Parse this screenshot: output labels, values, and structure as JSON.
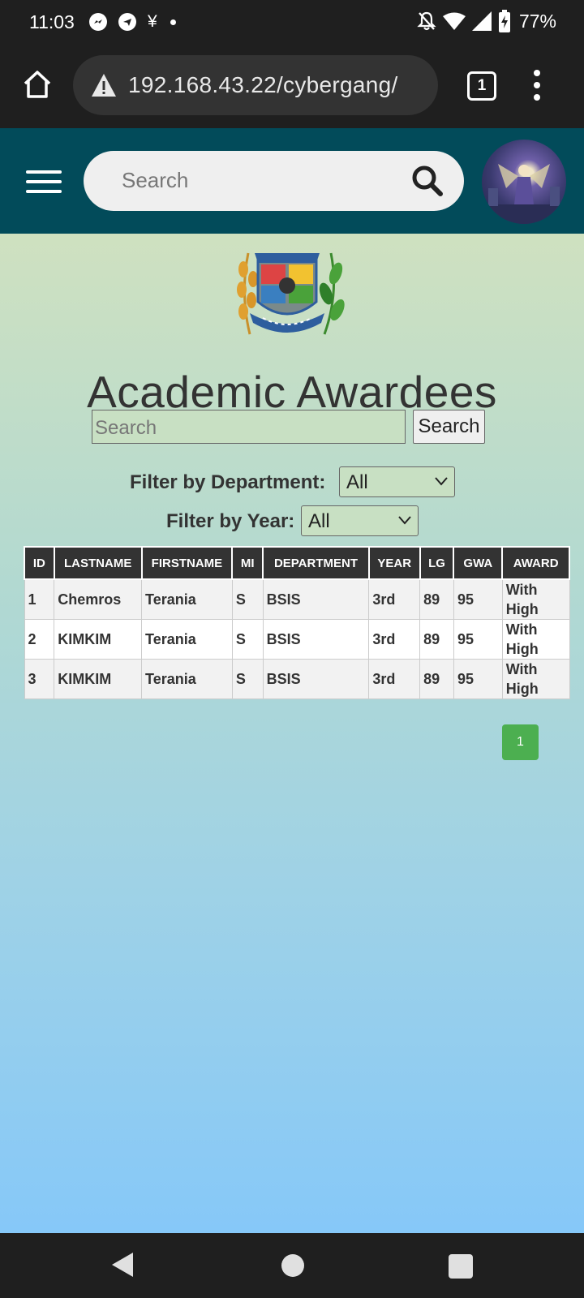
{
  "status_bar": {
    "time": "11:03",
    "notification_icons": [
      "messenger-icon",
      "telegram-icon",
      "yen-icon",
      "dot"
    ],
    "yen_symbol": "¥",
    "battery": "77%"
  },
  "browser": {
    "url": "192.168.43.22/cybergang/",
    "tab_count": "1"
  },
  "site_header": {
    "search_placeholder": "Search"
  },
  "page": {
    "title": "Academic Awardees",
    "search_placeholder": "Search",
    "search_button": "Search",
    "filter_department_label": "Filter by Department:",
    "filter_department_value": "All",
    "filter_year_label": "Filter by Year:",
    "filter_year_value": "All"
  },
  "table": {
    "headers": [
      "ID",
      "LASTNAME",
      "FIRSTNAME",
      "MI",
      "DEPARTMENT",
      "YEAR",
      "LG",
      "GWA",
      "AWARD"
    ],
    "rows": [
      [
        "1",
        "Chemros",
        "Terania",
        "S",
        "BSIS",
        "3rd",
        "89",
        "95",
        "With High"
      ],
      [
        "2",
        "KIMKIM",
        "Terania",
        "S",
        "BSIS",
        "3rd",
        "89",
        "95",
        "With High"
      ],
      [
        "3",
        "KIMKIM",
        "Terania",
        "S",
        "BSIS",
        "3rd",
        "89",
        "95",
        "With High"
      ]
    ]
  },
  "pagination": {
    "current_page": "1"
  },
  "colors": {
    "header_bg": "#024b5a",
    "table_header_bg": "#333333",
    "pager_bg": "#4caf50"
  }
}
